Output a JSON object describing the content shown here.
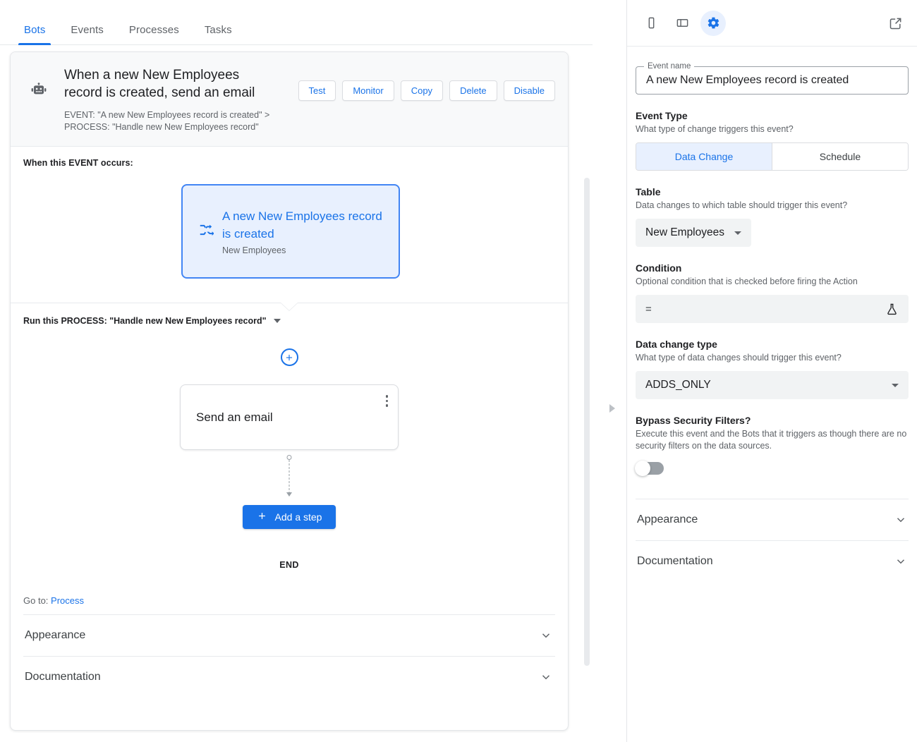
{
  "tabs": [
    {
      "label": "Bots",
      "active": true
    },
    {
      "label": "Events",
      "active": false
    },
    {
      "label": "Processes",
      "active": false
    },
    {
      "label": "Tasks",
      "active": false
    }
  ],
  "bot": {
    "title": "When a new New Employees record is created, send an email",
    "subtitle_line1": "EVENT: \"A new New Employees record is created\" >",
    "subtitle_line2": "PROCESS: \"Handle new New Employees record\"",
    "icon": "robot-icon",
    "actions": [
      {
        "label": "Test"
      },
      {
        "label": "Monitor"
      },
      {
        "label": "Copy"
      },
      {
        "label": "Delete"
      },
      {
        "label": "Disable"
      }
    ]
  },
  "event_section": {
    "label": "When this EVENT occurs:",
    "card": {
      "icon": "shuffle-icon",
      "title": "A new New Employees record is created",
      "subtitle": "New Employees"
    }
  },
  "process_section": {
    "label": "Run this PROCESS: \"Handle new New Employees record\"",
    "dropdown_icon": "caret-down-icon"
  },
  "flow": {
    "add_branch_icon": "plus-circle-icon",
    "step": {
      "title": "Send an email",
      "menu_icon": "more-vertical-icon"
    },
    "add_step_label": "Add a step",
    "add_step_icon": "plus-icon",
    "end_label": "END"
  },
  "footer": {
    "goto_prefix": "Go to:",
    "goto_link": "Process",
    "accordions": [
      {
        "label": "Appearance"
      },
      {
        "label": "Documentation"
      }
    ]
  },
  "right_panel": {
    "toolbar": [
      {
        "name": "mobile-preview",
        "icon": "phone-icon",
        "active": false
      },
      {
        "name": "tablet-preview",
        "icon": "tablet-icon",
        "active": false
      },
      {
        "name": "settings",
        "icon": "gear-icon",
        "active": true
      },
      {
        "name": "open-external",
        "icon": "external-link-icon",
        "active": false
      }
    ],
    "event_name": {
      "legend": "Event name",
      "value": "A new New Employees record is created"
    },
    "event_type": {
      "title": "Event Type",
      "description": "What type of change triggers this event?",
      "options": [
        {
          "label": "Data Change",
          "active": true
        },
        {
          "label": "Schedule",
          "active": false
        }
      ]
    },
    "table": {
      "title": "Table",
      "description": "Data changes to which table should trigger this event?",
      "value": "New Employees"
    },
    "condition": {
      "title": "Condition",
      "description": "Optional condition that is checked before firing the Action",
      "value": "=",
      "action_icon": "flask-icon"
    },
    "data_change_type": {
      "title": "Data change type",
      "description": "What type of data changes should trigger this event?",
      "value": "ADDS_ONLY"
    },
    "bypass_security": {
      "title": "Bypass Security Filters?",
      "description": "Execute this event and the Bots that it triggers as though there are no security filters on the data sources.",
      "enabled": false
    },
    "accordions": [
      {
        "label": "Appearance"
      },
      {
        "label": "Documentation"
      }
    ]
  },
  "colors": {
    "accent": "#1a73e8",
    "accent_light": "#e8f0fe",
    "text": "#202124",
    "muted": "#5f6368",
    "border": "#dadce0"
  }
}
